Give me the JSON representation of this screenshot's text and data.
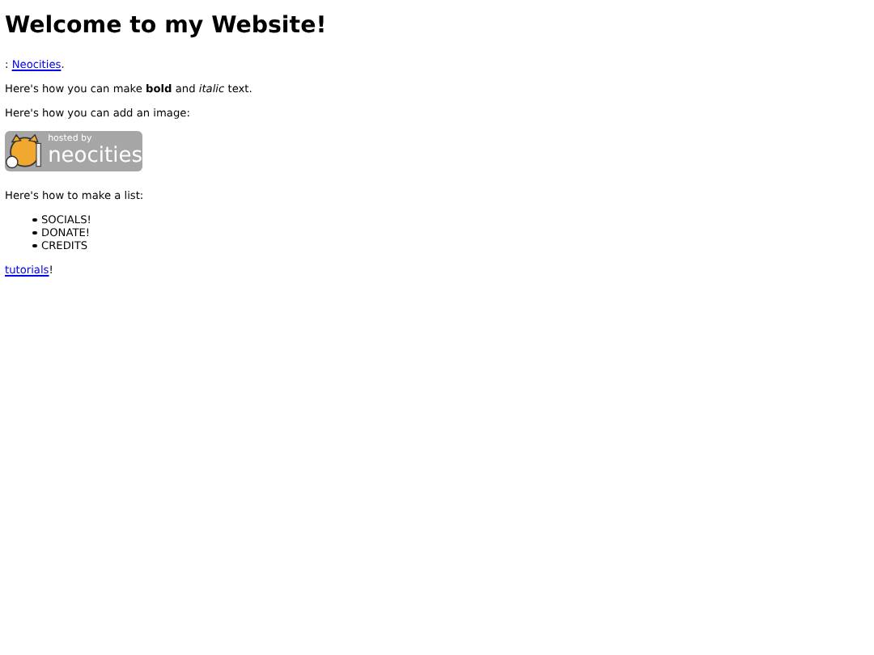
{
  "heading": "Welcome to my Website!",
  "intro": {
    "prefix": ": ",
    "link": "Neocities",
    "suffix": "."
  },
  "paragraphs": [
    "Here's how you can make **bold** and *italic* text.",
    "Here's how you can add an image:"
  ],
  "badge": {
    "line_1": "hosted by",
    "line_2": "neocities"
  },
  "list_intro": "Here's how to make a list:",
  "list": [
    "SOCIALS!",
    "DONATE!",
    "CREDITS"
  ],
  "outro": {
    "link": "tutorials",
    "suffix": "!"
  }
}
